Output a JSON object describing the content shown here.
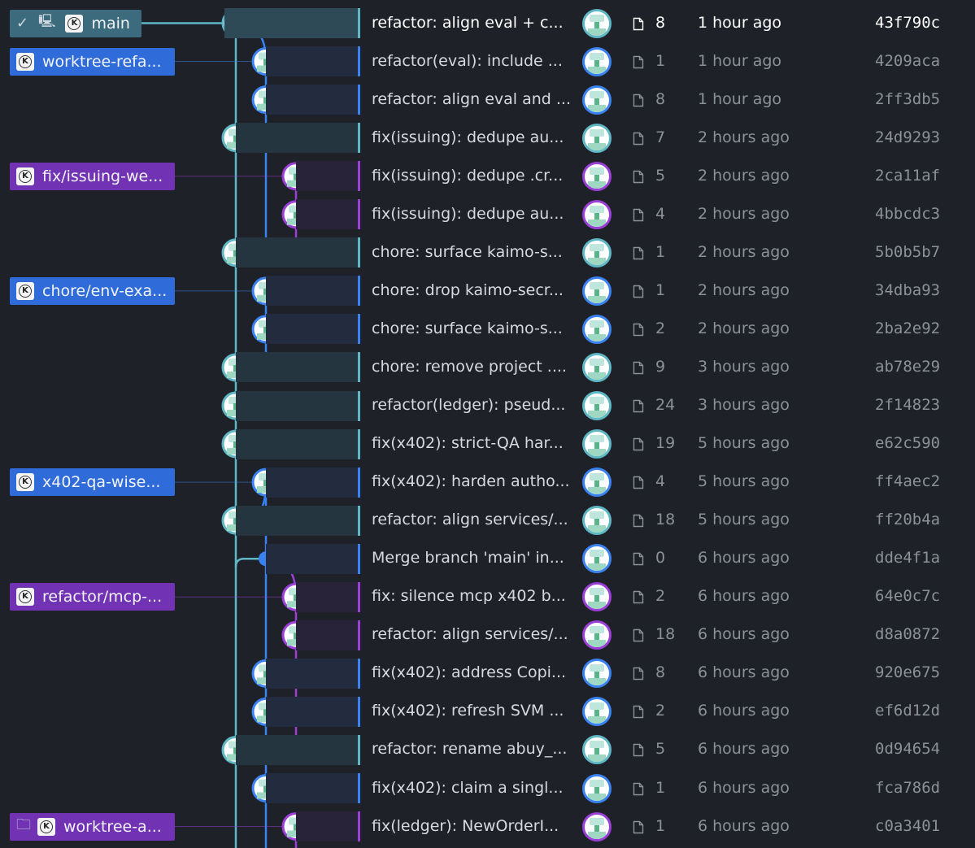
{
  "graph": {
    "refs": [
      {
        "row": 0,
        "name": "main",
        "color": "teal",
        "current": true,
        "check_icon": "check-icon",
        "computer_icon": "computer-icon"
      },
      {
        "row": 1,
        "name": "worktree-refa...",
        "color": "blue"
      },
      {
        "row": 4,
        "name": "fix/issuing-we...",
        "color": "purple"
      },
      {
        "row": 7,
        "name": "chore/env-exa...",
        "color": "blue"
      },
      {
        "row": 12,
        "name": "x402-qa-wise...",
        "color": "blue"
      },
      {
        "row": 15,
        "name": "refactor/mcp-...",
        "color": "purple"
      },
      {
        "row": 21,
        "name": "worktree-a...",
        "color": "purple",
        "worktree_icon": "worktree-icon"
      }
    ],
    "commits": [
      {
        "message": "refactor: align eval + c...",
        "files": "8",
        "time": "1 hour ago",
        "sha": "43f790c",
        "lane": 0,
        "color": "teal",
        "selected": true
      },
      {
        "message": "refactor(eval): include ...",
        "files": "1",
        "time": "1 hour ago",
        "sha": "4209aca",
        "lane": 1,
        "color": "blue"
      },
      {
        "message": "refactor: align eval and ...",
        "files": "8",
        "time": "1 hour ago",
        "sha": "2ff3db5",
        "lane": 1,
        "color": "blue"
      },
      {
        "message": "fix(issuing): dedupe au...",
        "files": "7",
        "time": "2 hours ago",
        "sha": "24d9293",
        "lane": 0,
        "color": "teal"
      },
      {
        "message": "fix(issuing): dedupe .cr...",
        "files": "5",
        "time": "2 hours ago",
        "sha": "2ca11af",
        "lane": 2,
        "color": "purple"
      },
      {
        "message": "fix(issuing): dedupe au...",
        "files": "4",
        "time": "2 hours ago",
        "sha": "4bbcdc3",
        "lane": 2,
        "color": "purple"
      },
      {
        "message": "chore: surface kaimo-s...",
        "files": "1",
        "time": "2 hours ago",
        "sha": "5b0b5b7",
        "lane": 0,
        "color": "teal"
      },
      {
        "message": "chore: drop kaimo-secr...",
        "files": "1",
        "time": "2 hours ago",
        "sha": "34dba93",
        "lane": 1,
        "color": "blue"
      },
      {
        "message": "chore: surface kaimo-s...",
        "files": "2",
        "time": "2 hours ago",
        "sha": "2ba2e92",
        "lane": 1,
        "color": "blue"
      },
      {
        "message": "chore: remove project ....",
        "files": "9",
        "time": "3 hours ago",
        "sha": "ab78e29",
        "lane": 0,
        "color": "teal"
      },
      {
        "message": "refactor(ledger): pseud...",
        "files": "24",
        "time": "3 hours ago",
        "sha": "2f14823",
        "lane": 0,
        "color": "teal"
      },
      {
        "message": "fix(x402): strict-QA har...",
        "files": "19",
        "time": "5 hours ago",
        "sha": "e62c590",
        "lane": 0,
        "color": "teal"
      },
      {
        "message": "fix(x402): harden autho...",
        "files": "4",
        "time": "5 hours ago",
        "sha": "ff4aec2",
        "lane": 1,
        "color": "blue"
      },
      {
        "message": "refactor: align services/...",
        "files": "18",
        "time": "5 hours ago",
        "sha": "ff20b4a",
        "lane": 0,
        "color": "teal"
      },
      {
        "message": "Merge branch 'main' in...",
        "files": "0",
        "time": "6 hours ago",
        "sha": "dde4f1a",
        "lane": 1,
        "color": "blue",
        "merge": true
      },
      {
        "message": "fix: silence mcp x402 b...",
        "files": "2",
        "time": "6 hours ago",
        "sha": "64e0c7c",
        "lane": 2,
        "color": "purple"
      },
      {
        "message": "refactor: align services/...",
        "files": "18",
        "time": "6 hours ago",
        "sha": "d8a0872",
        "lane": 2,
        "color": "purple"
      },
      {
        "message": "fix(x402): address Copi...",
        "files": "8",
        "time": "6 hours ago",
        "sha": "920e675",
        "lane": 1,
        "color": "blue"
      },
      {
        "message": "fix(x402): refresh SVM ...",
        "files": "2",
        "time": "6 hours ago",
        "sha": "ef6d12d",
        "lane": 1,
        "color": "blue"
      },
      {
        "message": "refactor: rename abuy_...",
        "files": "5",
        "time": "6 hours ago",
        "sha": "0d94654",
        "lane": 0,
        "color": "teal"
      },
      {
        "message": "fix(x402): claim a singl...",
        "files": "1",
        "time": "6 hours ago",
        "sha": "fca786d",
        "lane": 1,
        "color": "blue"
      },
      {
        "message": "fix(ledger): NewOrderI...",
        "files": "1",
        "time": "6 hours ago",
        "sha": "c0a3401",
        "lane": 2,
        "color": "purple"
      }
    ]
  },
  "colors": {
    "teal": "#5fb7c5",
    "blue": "#3a82f2",
    "purple": "#9b3fd8",
    "background": "#1f2128"
  }
}
